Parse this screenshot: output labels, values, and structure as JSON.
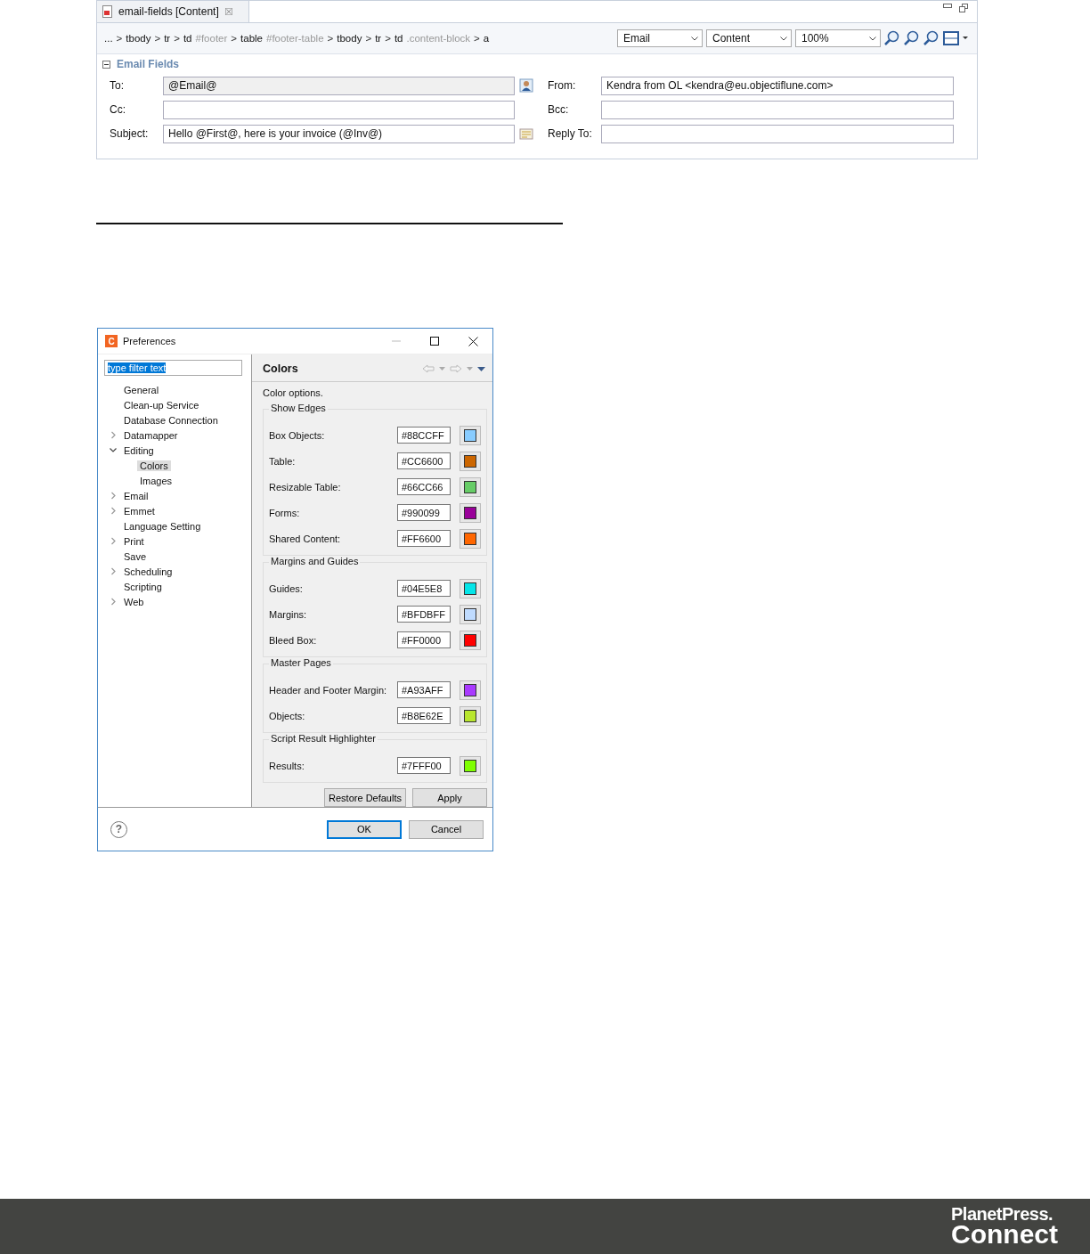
{
  "editor": {
    "tab": {
      "title": "email-fields [Content]",
      "close": "☒"
    },
    "breadcrumb": [
      {
        "text": "...",
        "kind": "tag"
      },
      {
        "text": ">",
        "kind": "sep"
      },
      {
        "text": "tbody",
        "kind": "tag"
      },
      {
        "text": ">",
        "kind": "sep"
      },
      {
        "text": "tr",
        "kind": "tag"
      },
      {
        "text": ">",
        "kind": "sep"
      },
      {
        "text": "td",
        "kind": "tag"
      },
      {
        "text": "#footer",
        "kind": "attr"
      },
      {
        "text": ">",
        "kind": "sep"
      },
      {
        "text": "table",
        "kind": "tag"
      },
      {
        "text": "#footer-table",
        "kind": "attr"
      },
      {
        "text": ">",
        "kind": "sep"
      },
      {
        "text": "tbody",
        "kind": "tag"
      },
      {
        "text": ">",
        "kind": "sep"
      },
      {
        "text": "tr",
        "kind": "tag"
      },
      {
        "text": ">",
        "kind": "sep"
      },
      {
        "text": "td",
        "kind": "tag"
      },
      {
        "text": ".content-block",
        "kind": "attr"
      },
      {
        "text": ">",
        "kind": "sep"
      },
      {
        "text": "a",
        "kind": "tag"
      }
    ],
    "combos": [
      "Email",
      "Content",
      "100%"
    ],
    "section": {
      "title": "Email Fields",
      "expanded": true
    },
    "left_fields": [
      {
        "label": "To:",
        "value": "@Email@",
        "disabled": true,
        "kind": "contact"
      },
      {
        "label": "Cc:",
        "disabled": false,
        "kind": "plain"
      },
      {
        "label": "Subject:",
        "value": "Hello @First@, here is your invoice (@Inv@)",
        "disabled": false,
        "kind": "message"
      }
    ],
    "right_fields": [
      {
        "label": "From:",
        "value": "Kendra from OL <kendra@eu.objectiflune.com>",
        "disabled": false
      },
      {
        "label": "Bcc:",
        "disabled": false
      },
      {
        "label": "Reply To:",
        "disabled": false
      }
    ]
  },
  "dialog": {
    "logo": "C",
    "title": "Preferences",
    "filter": {
      "value": "type filter text",
      "selected": true
    },
    "tree": [
      {
        "label": "General",
        "selected": false
      },
      {
        "label": "Clean-up Service",
        "selected": false
      },
      {
        "label": "Database Connection",
        "selected": false
      },
      {
        "label": "Datamapper",
        "selected": false,
        "expanded": false
      },
      {
        "label": "Editing",
        "selected": false,
        "expanded": true,
        "children": [
          {
            "label": "Colors",
            "selected": true
          },
          {
            "label": "Images",
            "selected": false
          }
        ]
      },
      {
        "label": "Email",
        "selected": false,
        "expanded": false
      },
      {
        "label": "Emmet",
        "selected": false,
        "expanded": false
      },
      {
        "label": "Language Setting",
        "selected": false
      },
      {
        "label": "Print",
        "selected": false,
        "expanded": false
      },
      {
        "label": "Save",
        "selected": false
      },
      {
        "label": "Scheduling",
        "selected": false,
        "expanded": false
      },
      {
        "label": "Scripting",
        "selected": false
      },
      {
        "label": "Web",
        "selected": false,
        "expanded": false
      }
    ],
    "page_title": "Colors",
    "description": "Color options.",
    "groups": [
      {
        "title": "Show Edges",
        "rows": [
          {
            "label": "Box Objects:",
            "value": "#88CCFF",
            "color": "#88ccff"
          },
          {
            "label": "Table:",
            "value": "#CC6600",
            "color": "#cc6600"
          },
          {
            "label": "Resizable Table:",
            "value": "#66CC66",
            "color": "#66cc66"
          },
          {
            "label": "Forms:",
            "value": "#990099",
            "color": "#990099"
          },
          {
            "label": "Shared Content:",
            "value": "#FF6600",
            "color": "#ff6600"
          }
        ]
      },
      {
        "title": "Margins and Guides",
        "rows": [
          {
            "label": "Guides:",
            "value": "#04E5E8",
            "color": "#04e5e8"
          },
          {
            "label": "Margins:",
            "value": "#BFDBFF",
            "color": "#bfdbff"
          },
          {
            "label": "Bleed Box:",
            "value": "#FF0000",
            "color": "#ff0000"
          }
        ]
      },
      {
        "title": "Master Pages",
        "rows": [
          {
            "label": "Header and Footer Margin:",
            "value": "#A93AFF",
            "color": "#a93aff"
          },
          {
            "label": "Objects:",
            "value": "#B8E62E",
            "color": "#b8e62e"
          }
        ]
      },
      {
        "title": "Script Result Highlighter",
        "rows": [
          {
            "label": "Results:",
            "value": "#7FFF00",
            "color": "#7fff00"
          }
        ]
      }
    ],
    "page_buttons": [
      "Restore Defaults",
      "Apply"
    ],
    "help": "?",
    "buttons": [
      {
        "label": "OK",
        "selected": true
      },
      {
        "label": "Cancel",
        "selected": false
      }
    ]
  },
  "footer": {
    "brand": "PlanetPress.",
    "product": "Connect"
  }
}
